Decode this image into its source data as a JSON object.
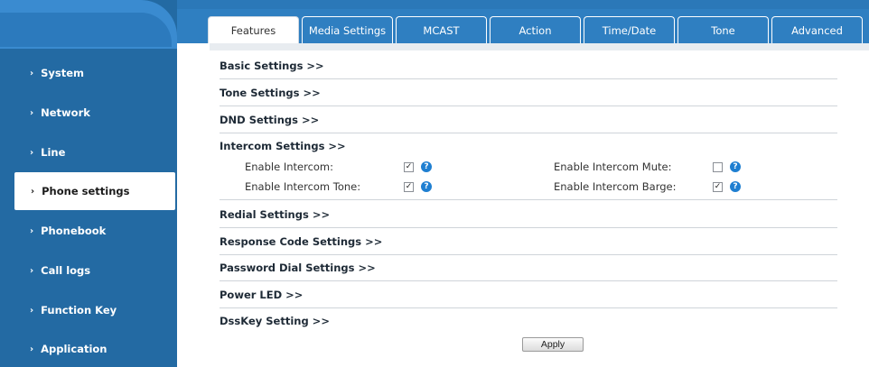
{
  "tabs": [
    {
      "label": "Features",
      "active": true
    },
    {
      "label": "Media Settings",
      "active": false
    },
    {
      "label": "MCAST",
      "active": false
    },
    {
      "label": "Action",
      "active": false
    },
    {
      "label": "Time/Date",
      "active": false
    },
    {
      "label": "Tone",
      "active": false
    },
    {
      "label": "Advanced",
      "active": false
    }
  ],
  "sidebar": {
    "items": [
      {
        "label": "System",
        "active": false
      },
      {
        "label": "Network",
        "active": false
      },
      {
        "label": "Line",
        "active": false
      },
      {
        "label": "Phone settings",
        "active": true
      },
      {
        "label": "Phonebook",
        "active": false
      },
      {
        "label": "Call logs",
        "active": false
      },
      {
        "label": "Function Key",
        "active": false
      },
      {
        "label": "Application",
        "active": false
      }
    ]
  },
  "sections": {
    "basic": "Basic Settings >>",
    "tone": "Tone Settings >>",
    "dnd": "DND Settings >>",
    "intercom": "Intercom Settings >>",
    "redial": "Redial Settings >>",
    "response_code": "Response Code Settings >>",
    "password_dial": "Password Dial Settings >>",
    "power_led": "Power LED >>",
    "dsskey": "DssKey Setting >>"
  },
  "intercom": {
    "enable_intercom": {
      "label": "Enable Intercom:",
      "checked": true
    },
    "enable_intercom_tone": {
      "label": "Enable Intercom Tone:",
      "checked": true
    },
    "enable_intercom_mute": {
      "label": "Enable Intercom Mute:",
      "checked": false
    },
    "enable_intercom_barge": {
      "label": "Enable Intercom Barge:",
      "checked": true
    }
  },
  "icons": {
    "chevron": "›",
    "check": "✓",
    "help": "?"
  },
  "colors": {
    "brand_blue": "#2f7fc1",
    "sidebar_blue": "#236aa3",
    "help_blue": "#1f7fd1"
  },
  "apply_label": "Apply"
}
